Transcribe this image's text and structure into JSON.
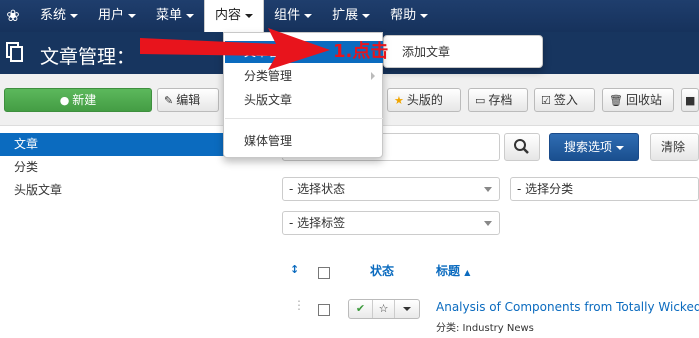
{
  "topnav": {
    "items": [
      {
        "label": "系统"
      },
      {
        "label": "用户"
      },
      {
        "label": "菜单"
      },
      {
        "label": "内容"
      },
      {
        "label": "组件"
      },
      {
        "label": "扩展"
      },
      {
        "label": "帮助"
      }
    ],
    "active": "内容"
  },
  "header": {
    "title": "文章管理："
  },
  "toolbar": {
    "new_label": "新建",
    "edit_label": "编辑",
    "featured_label": "头版的",
    "archive_label": "存档",
    "checkin_label": "签入",
    "trash_label": "回收站"
  },
  "sidebar": {
    "items": [
      {
        "label": "文章",
        "active": true
      },
      {
        "label": "分类",
        "active": false
      },
      {
        "label": "头版文章",
        "active": false
      }
    ]
  },
  "search": {
    "placeholder": "",
    "options_label": "搜索选项",
    "clear_label": "清除"
  },
  "filters": {
    "status": "- 选择状态",
    "category": "- 选择分类",
    "tag": "- 选择标签"
  },
  "table": {
    "headers": {
      "status": "状态",
      "title": "标题"
    },
    "rows": [
      {
        "title": "Analysis of Components from Totally Wicked",
        "category": "分类: Industry News"
      }
    ]
  },
  "dropdown": {
    "items": [
      {
        "label": "文章管理",
        "active": true
      },
      {
        "label": "分类管理",
        "has_submenu": true
      },
      {
        "label": "头版文章"
      },
      {
        "label": "媒体管理"
      }
    ],
    "submenu_item": "添加文章"
  },
  "annotation": {
    "text": "1.点击",
    "color": "#e8141c"
  },
  "colors": {
    "nav_bg": "#1a3867",
    "accent": "#0b6bbf",
    "new_button": "#5cb85c",
    "search_options": "#1f5a9e"
  }
}
